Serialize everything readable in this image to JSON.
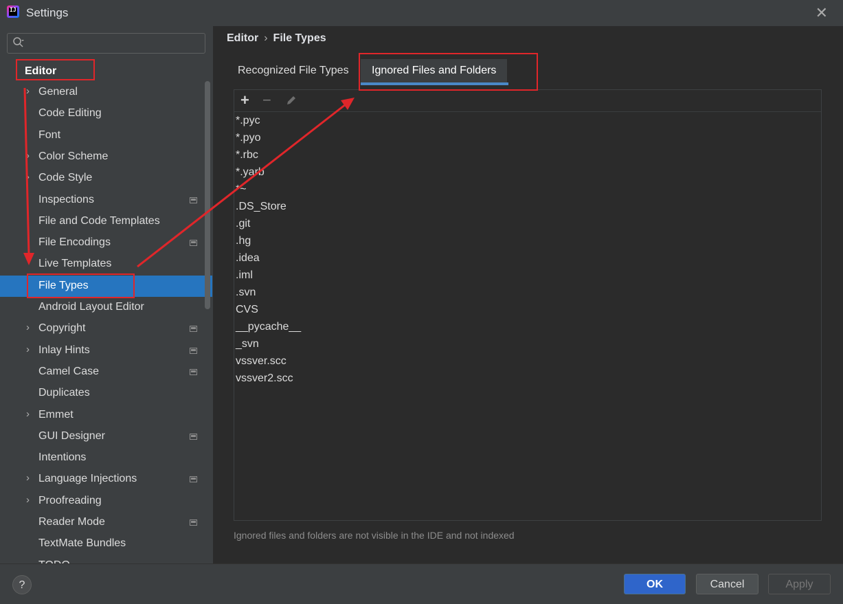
{
  "window": {
    "title": "Settings",
    "app_icon_label": "IJ"
  },
  "sidebar": {
    "search": {
      "placeholder": "",
      "value": ""
    },
    "root_label": "Editor",
    "items": [
      {
        "label": "General",
        "expandable": true,
        "project_icon": false,
        "selected": false
      },
      {
        "label": "Code Editing",
        "expandable": false,
        "project_icon": false,
        "selected": false
      },
      {
        "label": "Font",
        "expandable": false,
        "project_icon": false,
        "selected": false
      },
      {
        "label": "Color Scheme",
        "expandable": true,
        "project_icon": false,
        "selected": false
      },
      {
        "label": "Code Style",
        "expandable": true,
        "project_icon": false,
        "selected": false
      },
      {
        "label": "Inspections",
        "expandable": false,
        "project_icon": true,
        "selected": false
      },
      {
        "label": "File and Code Templates",
        "expandable": false,
        "project_icon": false,
        "selected": false
      },
      {
        "label": "File Encodings",
        "expandable": false,
        "project_icon": true,
        "selected": false
      },
      {
        "label": "Live Templates",
        "expandable": false,
        "project_icon": false,
        "selected": false
      },
      {
        "label": "File Types",
        "expandable": false,
        "project_icon": false,
        "selected": true
      },
      {
        "label": "Android Layout Editor",
        "expandable": false,
        "project_icon": false,
        "selected": false
      },
      {
        "label": "Copyright",
        "expandable": true,
        "project_icon": true,
        "selected": false
      },
      {
        "label": "Inlay Hints",
        "expandable": true,
        "project_icon": true,
        "selected": false
      },
      {
        "label": "Camel Case",
        "expandable": false,
        "project_icon": true,
        "selected": false
      },
      {
        "label": "Duplicates",
        "expandable": false,
        "project_icon": false,
        "selected": false
      },
      {
        "label": "Emmet",
        "expandable": true,
        "project_icon": false,
        "selected": false
      },
      {
        "label": "GUI Designer",
        "expandable": false,
        "project_icon": true,
        "selected": false
      },
      {
        "label": "Intentions",
        "expandable": false,
        "project_icon": false,
        "selected": false
      },
      {
        "label": "Language Injections",
        "expandable": true,
        "project_icon": true,
        "selected": false
      },
      {
        "label": "Proofreading",
        "expandable": true,
        "project_icon": false,
        "selected": false
      },
      {
        "label": "Reader Mode",
        "expandable": false,
        "project_icon": true,
        "selected": false
      },
      {
        "label": "TextMate Bundles",
        "expandable": false,
        "project_icon": false,
        "selected": false
      },
      {
        "label": "TODO",
        "expandable": false,
        "project_icon": false,
        "selected": false
      }
    ]
  },
  "breadcrumb": {
    "parent": "Editor",
    "separator": "›",
    "current": "File Types"
  },
  "tabs": [
    {
      "label": "Recognized File Types",
      "active": false
    },
    {
      "label": "Ignored Files and Folders",
      "active": true
    }
  ],
  "toolbar": {
    "add": "+",
    "remove": "−",
    "edit_icon": "pencil-icon"
  },
  "ignored_items": [
    "*.pyc",
    "*.pyo",
    "*.rbc",
    "*.yarb",
    "*~",
    ".DS_Store",
    ".git",
    ".hg",
    ".idea",
    ".iml",
    ".svn",
    "CVS",
    "__pycache__",
    "_svn",
    "vssver.scc",
    "vssver2.scc"
  ],
  "hint": "Ignored files and folders are not visible in the IDE and not indexed",
  "footer": {
    "help": "?",
    "ok": "OK",
    "cancel": "Cancel",
    "apply": "Apply"
  },
  "colors": {
    "annotation_red": "#e0262a",
    "selection": "#2675bf",
    "ok_button": "#2f65ca",
    "tab_underline": "#4a88c7"
  }
}
